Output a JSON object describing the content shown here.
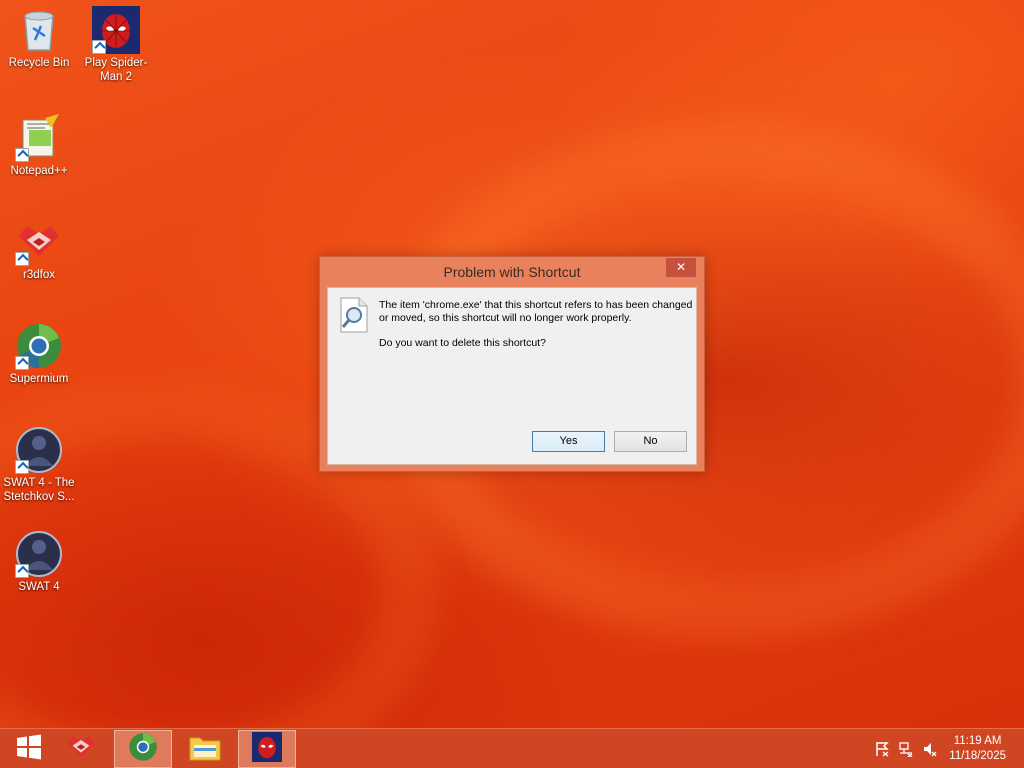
{
  "desktop": {
    "icons": [
      {
        "id": "recycle-bin",
        "label": "Recycle Bin"
      },
      {
        "id": "spiderman",
        "label": "Play Spider-Man 2"
      },
      {
        "id": "notepadpp",
        "label": "Notepad++"
      },
      {
        "id": "r3dfox",
        "label": "r3dfox"
      },
      {
        "id": "supermium",
        "label": "Supermium"
      },
      {
        "id": "swat4-stetchkov",
        "label": "SWAT 4 - The Stetchkov S..."
      },
      {
        "id": "swat4",
        "label": "SWAT 4"
      }
    ]
  },
  "dialog": {
    "title": "Problem with Shortcut",
    "close_glyph": "✕",
    "message_line1": "The item 'chrome.exe' that this shortcut refers to has been changed or moved, so this shortcut will no longer work properly.",
    "message_line2": "Do you want to delete this shortcut?",
    "yes_label": "Yes",
    "no_label": "No"
  },
  "taskbar": {
    "items": [
      "start-button",
      "r3dfox",
      "supermium",
      "file-explorer",
      "spiderman"
    ],
    "tray_icons": [
      "flag-icon",
      "network-icon",
      "volume-muted-icon"
    ],
    "clock_time": "11:19 AM",
    "clock_date": "11/18/2025"
  },
  "colors": {
    "wallpaper": "#e8400f",
    "dialog_frame": "#e9825c",
    "close_button": "#c7503f",
    "taskbar": "#cd4623"
  }
}
